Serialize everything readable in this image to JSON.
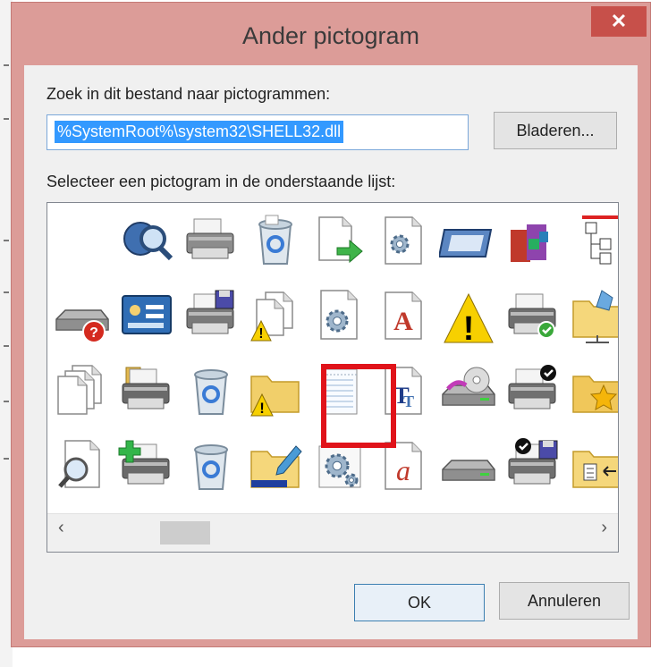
{
  "dialog": {
    "title": "Ander pictogram",
    "close_symbol": "✕",
    "search_label": "Zoek in dit bestand naar pictogrammen:",
    "path_value": "%SystemRoot%\\system32\\SHELL32.dll",
    "browse_label": "Bladeren...",
    "list_label": "Selecteer een pictogram in de onderstaande lijst:",
    "ok_label": "OK",
    "cancel_label": "Annuleren",
    "scroll_left": "‹",
    "scroll_right": "›"
  },
  "icons": [
    [
      "blank-icon",
      "network-search-icon",
      "printer-icon",
      "recycle-bin-full-icon",
      "file-export-icon",
      "document-search-icon",
      "monitor-window-icon",
      "applications-icon",
      "network-tree-icon"
    ],
    [
      "drive-help-icon",
      "control-panel-icon",
      "printer-save-icon",
      "documents-warning-icon",
      "settings-document-icon",
      "font-icon",
      "warning-icon",
      "printer-check-icon",
      "network-folder-icon"
    ],
    [
      "documents-icon",
      "printer-folder-icon",
      "recycle-bin-icon",
      "folder-warning-icon",
      "notepad-document-icon",
      "truetype-font-icon",
      "drive-disc-icon",
      "printer-default-icon",
      "favorites-folder-icon"
    ],
    [
      "search-file-icon",
      "printer-add-icon",
      "recycle-bin-empty-icon",
      "folder-edit-icon",
      "settings-window-icon",
      "text-font-icon",
      "drive-icon",
      "printer-default-save-icon",
      "folder-list-icon"
    ]
  ],
  "selected_icon": "notepad-document-icon",
  "colors": {
    "frame": "#dc9c98",
    "close": "#c7504a",
    "selection": "#3399ff",
    "highlight": "#e0131a",
    "ok_border": "#3c7fb1"
  }
}
